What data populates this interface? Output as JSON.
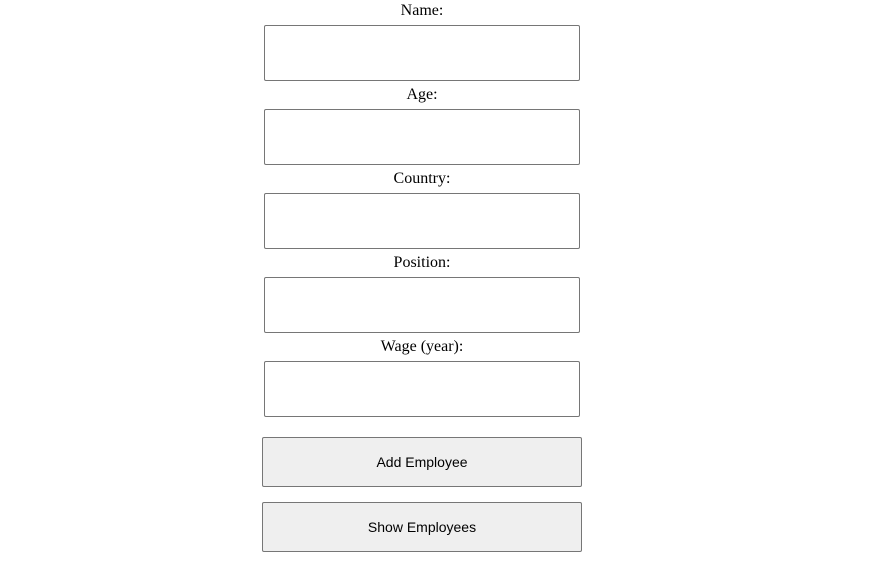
{
  "form": {
    "fields": [
      {
        "label": "Name:",
        "value": "",
        "placeholder": ""
      },
      {
        "label": "Age:",
        "value": "",
        "placeholder": ""
      },
      {
        "label": "Country:",
        "value": "",
        "placeholder": ""
      },
      {
        "label": "Position:",
        "value": "",
        "placeholder": ""
      },
      {
        "label": "Wage (year):",
        "value": "",
        "placeholder": ""
      }
    ],
    "add_button_label": "Add Employee",
    "show_button_label": "Show Employees"
  },
  "colors": {
    "background": "#ffffff",
    "input_border": "#767676",
    "button_background": "#efefef",
    "text": "#000000"
  }
}
